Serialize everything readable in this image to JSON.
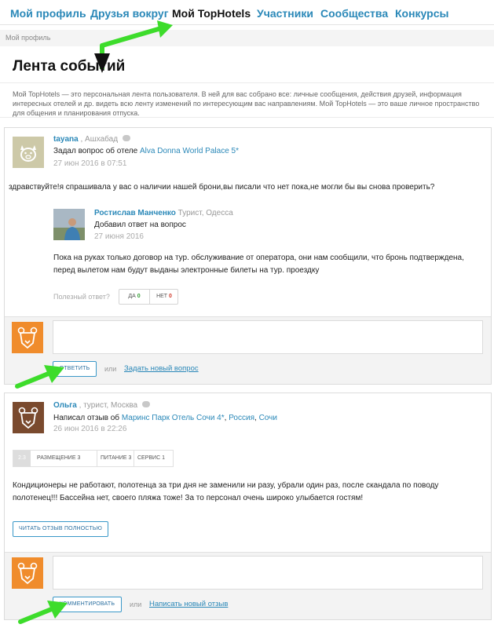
{
  "nav": {
    "my_profile": "Мой профиль",
    "friends": "Друзья вокруг",
    "my_tophotels": "Мой TopHotels",
    "members": "Участники",
    "communities": "Сообщества",
    "contests": "Конкурсы"
  },
  "breadcrumb": "Мой профиль",
  "page_title": "Лента событий",
  "intro": "Мой TopHotels — это персональная лента пользователя. В ней для вас собрано все: личные сообщения, действия друзей, информация интересных отелей и др. видеть всю ленту изменений по интересующим вас направлениям. Мой TopHotels — это ваше личное пространство для общения и планирования отпуска.",
  "event1": {
    "user": "tayana",
    "user_meta": ", Ашхабад",
    "action": "Задал вопрос об отеле",
    "hotel": "Alva Donna World Palace 5*",
    "date": "27 июн 2016 в 07:51",
    "question": "здравствуйте!я спрашивала у вас о наличии нашей брони,вы писали что нет пока,не могли бы вы снова проверить?",
    "answer": {
      "user": "Ростислав Манченко",
      "user_meta": "Турист, Одесса",
      "action": "Добавил ответ на вопрос",
      "date": "27 июня 2016",
      "text": "Пока на руках только договор на тур. обслуживание от оператора, они нам сообщили, что бронь подтверждена, перед вылетом нам будут выданы электронные билеты на тур. проездку",
      "useful_label": "Полезный ответ?",
      "yes_label": "да",
      "yes_count": "0",
      "no_label": "нет",
      "no_count": "0"
    },
    "reply_button": "ответить",
    "or": "или",
    "new_question_link": "Задать новый вопрос"
  },
  "event2": {
    "user": "Ольга",
    "user_meta": ", турист, Москва",
    "action": "Написал отзыв об",
    "hotel": "Маринс Парк Отель Сочи 4*",
    "country": "Россия",
    "city": "Сочи",
    "date": "26 июн 2016 в 22:26",
    "ratings": {
      "overall": "2.3",
      "items": [
        "Размещение 3",
        "Питание 3",
        "Сервис 1"
      ]
    },
    "review": "Кондиционеры не работают, полотенца за три дня не заменили ни разу, убрали один раз, после скандала по поводу полотенец!!! Бассейна нет, своего пляжа тоже! За то персонал очень широко улыбается гостям!",
    "read_more": "читать отзыв полностью",
    "comment_button": "комментировать",
    "or": "или",
    "new_review_link": "Написать новый отзыв"
  },
  "colors": {
    "link": "#2a88b8",
    "yes": "#2e9a2e",
    "no": "#d0392a",
    "arrow": "#3ddc2b",
    "bear_bg": "#f08c2c"
  },
  "icons": [
    "pig-avatar-icon",
    "bear-avatar-icon",
    "chat-bubble-icon",
    "green-arrow-icon"
  ]
}
